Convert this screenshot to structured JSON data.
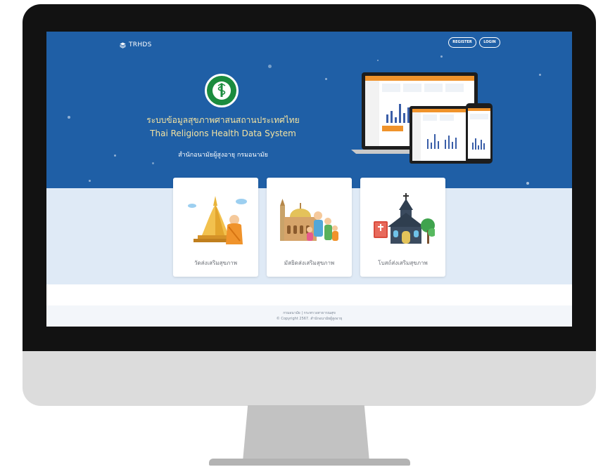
{
  "header": {
    "brand": "TRHDS",
    "register_label": "REGISTER",
    "login_label": "LOGIN"
  },
  "hero": {
    "title_th": "ระบบข้อมูลสุขภาพศาสนสถานประเทศไทย",
    "title_en": "Thai Religions Health Data System",
    "subtitle": "สำนักอนามัยผู้สูงอายุ กรมอนามัย"
  },
  "cards": [
    {
      "label": "วัดส่งเสริมสุขภาพ",
      "icon": "buddhist-temple-icon"
    },
    {
      "label": "มัสยิดส่งเสริมสุขภาพ",
      "icon": "mosque-icon"
    },
    {
      "label": "โบสถ์ส่งเสริมสุขภาพ",
      "icon": "church-icon"
    }
  ],
  "footer": {
    "line1": "กรมอนามัย | กระทรวงสาธารณสุข",
    "line2": "© Copyright 2567. สำนักอนามัยผู้สูงอายุ"
  },
  "colors": {
    "hero_blue": "#1f5fa6",
    "title_gold": "#f4e3a1",
    "band_light": "#dfeaf6",
    "monitor_bezel": "#121212",
    "accent_orange": "#f0932b"
  }
}
